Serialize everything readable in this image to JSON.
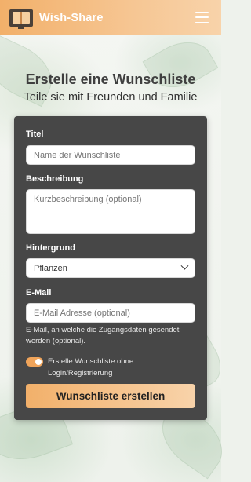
{
  "header": {
    "brand": "Wish-Share"
  },
  "hero": {
    "title": "Erstelle eine Wunschliste",
    "subtitle": "Teile sie mit Freunden und Familie"
  },
  "form": {
    "title_label": "Titel",
    "title_placeholder": "Name der Wunschliste",
    "description_label": "Beschreibung",
    "description_placeholder": "Kurzbeschreibung (optional)",
    "background_label": "Hintergrund",
    "background_value": "Pflanzen",
    "email_label": "E-Mail",
    "email_placeholder": "E-Mail Adresse (optional)",
    "email_hint": "E-Mail, an welche die Zugangsdaten gesendet werden (optional).",
    "toggle_label": "Erstelle Wunschliste ohne Login/Registrierung",
    "toggle_on": true,
    "submit_label": "Wunschliste erstellen"
  },
  "colors": {
    "accent": "#f2b06a",
    "card": "#474747"
  }
}
